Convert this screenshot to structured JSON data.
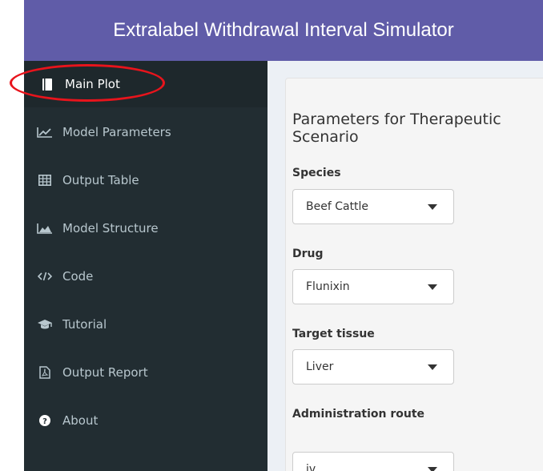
{
  "header": {
    "title": "Extralabel Withdrawal Interval Simulator"
  },
  "sidebar": {
    "items": [
      {
        "label": "Main Plot",
        "icon": "book-icon"
      },
      {
        "label": "Model Parameters",
        "icon": "line-chart-icon"
      },
      {
        "label": "Output Table",
        "icon": "table-icon"
      },
      {
        "label": "Model Structure",
        "icon": "area-chart-icon"
      },
      {
        "label": "Code",
        "icon": "code-icon"
      },
      {
        "label": "Tutorial",
        "icon": "graduation-cap-icon"
      },
      {
        "label": "Output Report",
        "icon": "pdf-file-icon"
      },
      {
        "label": "About",
        "icon": "question-circle-icon"
      }
    ]
  },
  "panel": {
    "title": "Parameters for Therapeutic Scenario",
    "fields": [
      {
        "label": "Species",
        "value": "Beef Cattle"
      },
      {
        "label": "Drug",
        "value": "Flunixin"
      },
      {
        "label": "Target tissue",
        "value": "Liver"
      },
      {
        "label": "Administration route",
        "value": "iv"
      }
    ]
  },
  "colors": {
    "header": "#605ca8",
    "sidebar": "#222d32",
    "sidebar_active": "#1e282c",
    "sidebar_text": "#b8c7ce",
    "annotation": "#e8141c"
  }
}
